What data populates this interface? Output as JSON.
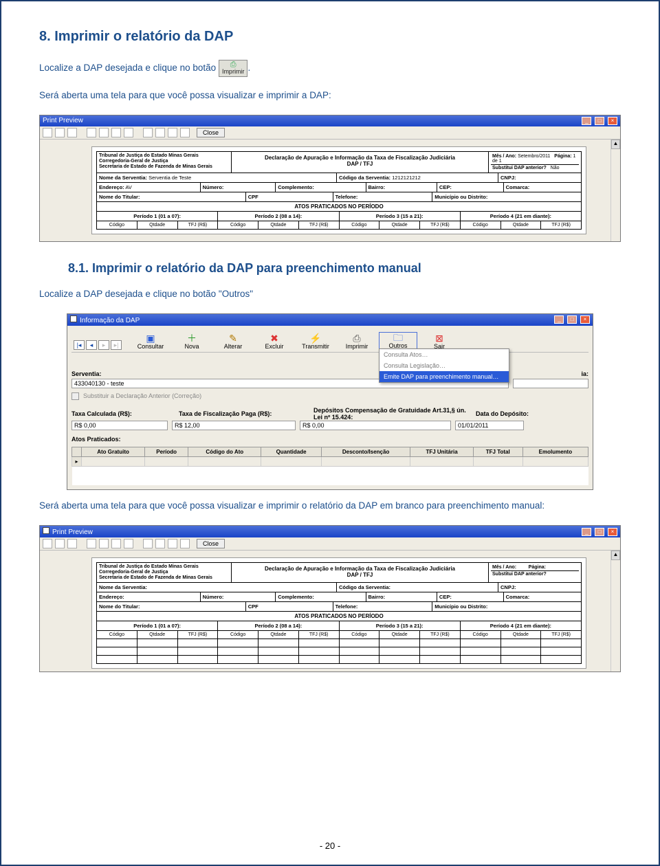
{
  "section_8": {
    "title": "8. Imprimir o relatório da DAP",
    "line1a": "Localize a DAP desejada e clique no botão ",
    "btn_label": "Imprimir",
    "line1b": ".",
    "line2": "Será aberta uma tela para que você possa visualizar e imprimir a DAP:"
  },
  "section_81": {
    "title": "8.1.    Imprimir o relatório da DAP para preenchimento manual",
    "line1": "Localize a DAP desejada e clique no botão \"Outros\"",
    "line2": "Será aberta uma tela para que você possa visualizar e imprimir o relatório da DAP em branco para preenchimento manual:"
  },
  "preview1": {
    "title": "Print Preview",
    "close": "Close",
    "org_l1": "Tribunal de Justiça do Estado Minas Gerais",
    "org_l2": "Corregedoria-Geral de Justiça",
    "org_l3": "Secretaria de Estado de Fazenda de Minas Gerais",
    "decl1": "Declaração de Apuração e Informação da Taxa de Fiscalização Judiciária",
    "decl2": "DAP / TFJ",
    "mes_ano_label": "Mês / Ano:",
    "mes_ano": "Setembro/2011",
    "pagina_label": "Página:",
    "pagina": "1 de 1",
    "substitui_label": "Substitui DAP anterior?",
    "substitui": "Não",
    "nome_serventia_label": "Nome da Serventia:",
    "nome_serventia": "Serventia de Teste",
    "cod_serventia_label": "Código da Serventia:",
    "cod_serventia": "1212121212",
    "cnpj_label": "CNPJ:",
    "endereco_label": "Endereço:",
    "endereco": "AV",
    "numero_label": "Número:",
    "complemento_label": "Complemento:",
    "bairro_label": "Bairro:",
    "cep_label": "CEP:",
    "comarca_label": "Comarca:",
    "nome_titular_label": "Nome do Titular:",
    "cpf_label": "CPF",
    "telefone_label": "Telefone:",
    "municipio_label": "Município ou Distrito:",
    "atos_header": "ATOS PRATICADOS NO PERÍODO",
    "periodo1": "Período 1 (01 a 07):",
    "periodo2": "Período 2 (08 a 14):",
    "periodo3": "Período 3 (15 a 21):",
    "periodo4": "Período 4 (21 em diante):",
    "col_codigo": "Código",
    "col_qtdade": "Qtdade",
    "col_tfj": "TFJ (R$)"
  },
  "dapform": {
    "title": "Informação da DAP",
    "btn_consultar": "Consultar",
    "btn_nova": "Nova",
    "btn_alterar": "Alterar",
    "btn_excluir": "Excluir",
    "btn_transmitir": "Transmitir",
    "btn_imprimir": "Imprimir",
    "btn_outros": "Outros",
    "btn_sair": "Sair",
    "menu_item1": "Consulta Atos…",
    "menu_item2": "Consulta Legislação…",
    "menu_item3": "Emite DAP para preenchimento manual…",
    "serventia_label": "Serventia:",
    "serventia": "433040130 - teste",
    "substituir": "Substituir a Declaração Anterior (Correção)",
    "taxa_calc_label": "Taxa Calculada (R$):",
    "taxa_calc": "R$ 0,00",
    "taxa_fisc_label": "Taxa de Fiscalização Paga (R$):",
    "taxa_fisc": "R$ 12,00",
    "depositos_label": "Depósitos Compensação de Gratuidade Art.31,§ ún. Lei nº 15.424:",
    "depositos": "R$ 0,00",
    "data_deposito_label": "Data do Depósito:",
    "data_deposito": "01/01/2011",
    "atos_praticados": "Atos Praticados:",
    "th_ato": "Ato Gratuito",
    "th_periodo": "Período",
    "th_cod": "Código do Ato",
    "th_qtd": "Quantidade",
    "th_desc": "Desconto/Isenção",
    "th_tfj_unit": "TFJ Unitária",
    "th_tfj_tot": "TFJ Total",
    "th_emol": "Emolumento",
    "competencia_suffix": "ia:"
  },
  "preview2": {
    "title": "Print Preview",
    "close": "Close",
    "mes_ano_label": "Mês / Ano:",
    "pagina_label": "Página:",
    "substitui_label": "Substitui DAP anterior?"
  },
  "page_number": "- 20 -"
}
